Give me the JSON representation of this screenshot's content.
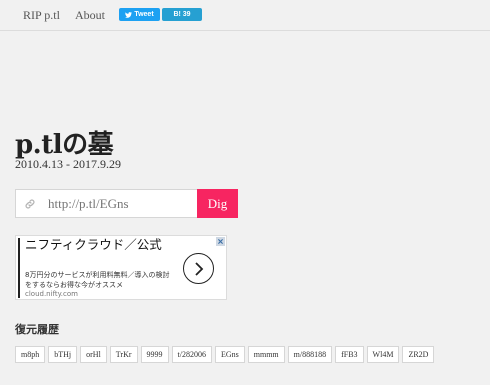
{
  "nav": {
    "home_label": "RIP p.tl",
    "about_label": "About"
  },
  "share": {
    "tweet_label": "Tweet",
    "hatena_label": "B! 39"
  },
  "main": {
    "title": "p.tlの墓",
    "dates": "2010.4.13 - 2017.9.29",
    "url_placeholder": "http://p.tl/EGns",
    "dig_label": "Dig"
  },
  "ad": {
    "headline": "ニフティクラウド／公式",
    "description": "8万円分のサービスが利用料無料／導入の検討をするならお得な今がオススメ",
    "domain": "cloud.nifty.com"
  },
  "history": {
    "heading": "復元履歴",
    "tags": [
      "m8ph",
      "bTHj",
      "orHl",
      "TrKr",
      "9999",
      "t/282006",
      "EGns",
      "mmmm",
      "m/888188",
      "fFB3",
      "Wl4M",
      "ZR2D"
    ]
  },
  "colors": {
    "dig": "#f72561",
    "tweet": "#1da1f2",
    "hatena": "#26a0d2"
  }
}
